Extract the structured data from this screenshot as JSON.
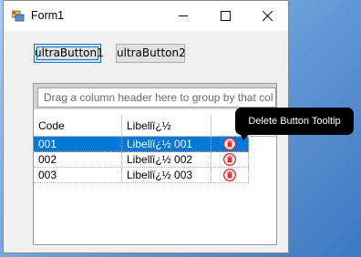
{
  "window": {
    "title": "Form1",
    "icon": "winforms-app-icon",
    "caption_buttons": [
      "minimize-icon",
      "maximize-icon",
      "close-icon"
    ]
  },
  "toolbar": {
    "button1_label": "ultraButton1",
    "button2_label": "ultraButton2"
  },
  "grid": {
    "group_by_prompt": "Drag a column header here to group by that col",
    "columns": [
      "Code",
      "Libellï¿½",
      ""
    ],
    "rows": [
      {
        "code": "001",
        "libelle": "Libellï¿½ 001",
        "action_icon": "trash-icon",
        "selected": true
      },
      {
        "code": "002",
        "libelle": "Libellï¿½ 002",
        "action_icon": "trash-icon",
        "selected": false
      },
      {
        "code": "003",
        "libelle": "Libellï¿½ 003",
        "action_icon": "trash-icon",
        "selected": false
      }
    ]
  },
  "tooltip": {
    "text": "Delete Button Tooltip"
  },
  "colors": {
    "selection": "#0078d7",
    "delete_icon": "#e0303c",
    "tooltip_bg": "#000000"
  }
}
